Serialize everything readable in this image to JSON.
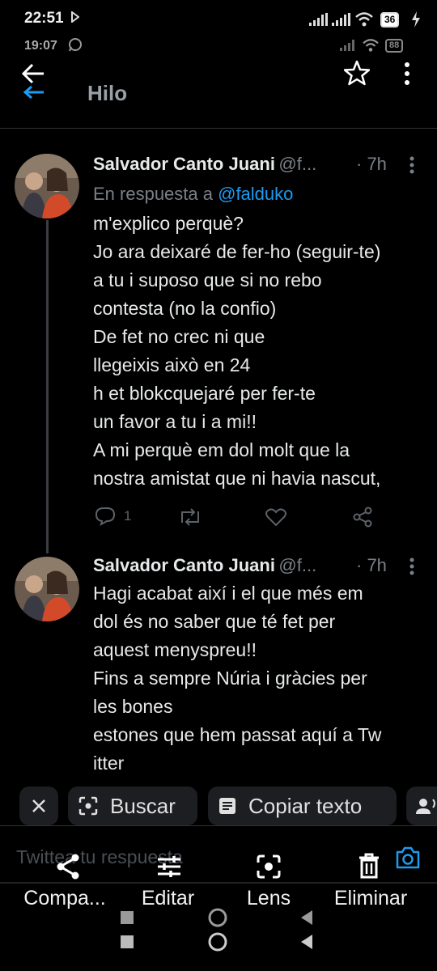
{
  "status_outer": {
    "time": "22:51",
    "battery": "36"
  },
  "status_inner": {
    "time": "19:07",
    "battery": "88"
  },
  "header": {
    "title": "Hilo"
  },
  "tweets": [
    {
      "author": "Salvador Canto Juani",
      "handle": "@f...",
      "time": "· 7h",
      "reply_prefix": "En respuesta a",
      "reply_mention": "@falduko",
      "text": "m'explico perquè?\nJo ara deixaré de fer-ho (seguir-te)\na tu i suposo que si no rebo\ncontesta (no la confio)\nDe fet no crec ni que\nllegeixis això en 24\nh et blokcquejaré per fer-te\nun favor a tu i a mi!!\nA mi perquè em dol molt que la\nnostra amistat que ni havia nascut,",
      "reply_count": "1"
    },
    {
      "author": "Salvador Canto Juani",
      "handle": "@f...",
      "time": "· 7h",
      "text": "Hagi acabat així i el que més em\ndol és no saber que té fet per\naquest menyspreu!!\nFins a sempre Núria i gràcies per\nles bones\nestones que hem passat aquí a Tw\nitter"
    }
  ],
  "lens_toolbar": {
    "search_label": "Buscar",
    "copy_label": "Copiar texto"
  },
  "compose": {
    "placeholder": "Twittea tu respuesta"
  },
  "bottom_actions": [
    {
      "label": "Compa...",
      "icon": "share-icon"
    },
    {
      "label": "Editar",
      "icon": "tune-icon"
    },
    {
      "label": "Lens",
      "icon": "lens-icon"
    },
    {
      "label": "Eliminar",
      "icon": "trash-icon"
    }
  ],
  "colors": {
    "accent": "#1d9bf0",
    "background": "#000000",
    "text": "#e7e9ea",
    "muted": "#7a8087"
  }
}
